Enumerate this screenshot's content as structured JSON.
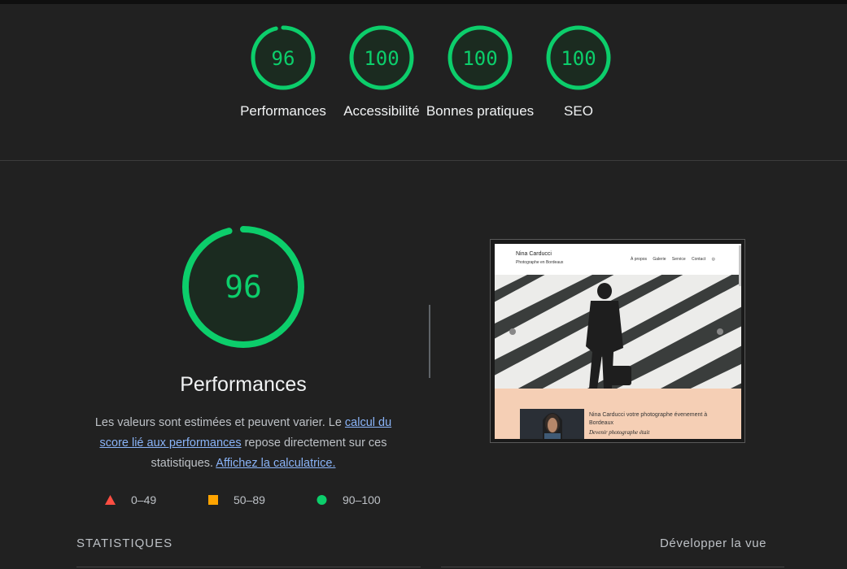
{
  "scores": [
    {
      "value": "96",
      "label": "Performances",
      "score": 96
    },
    {
      "value": "100",
      "label": "Accessibilité",
      "score": 100
    },
    {
      "value": "100",
      "label": "Bonnes pratiques",
      "score": 100
    },
    {
      "value": "100",
      "label": "SEO",
      "score": 100
    }
  ],
  "main": {
    "score": "96",
    "score_value": 96,
    "title": "Performances",
    "desc_1": "Les valeurs sont estimées et peuvent varier. Le ",
    "link_1": "calcul du score lié aux performances",
    "desc_2": " repose directement sur ces statistiques. ",
    "link_2": "Affichez la calculatrice."
  },
  "legend": [
    {
      "range": "0–49",
      "icon": "triangle-icon",
      "color": "#ff4e42"
    },
    {
      "range": "50–89",
      "icon": "square-icon",
      "color": "#ffa400"
    },
    {
      "range": "90–100",
      "icon": "circle-icon",
      "color": "#0cce6b"
    }
  ],
  "screenshot": {
    "site_name": "Nina Carducci",
    "site_subtitle": "Photographe en Bordeaux",
    "nav": [
      "À propos",
      "Galerie",
      "Service",
      "Contact"
    ],
    "headline": "Nina Carducci votre photographe évenement à Bordeaux",
    "subheadline": "Devenir photographe était"
  },
  "statistics": {
    "title": "STATISTIQUES",
    "expand_label": "Développer la vue"
  },
  "colors": {
    "pass": "#0cce6b",
    "background": "#212121",
    "link": "#8ab4f8"
  }
}
